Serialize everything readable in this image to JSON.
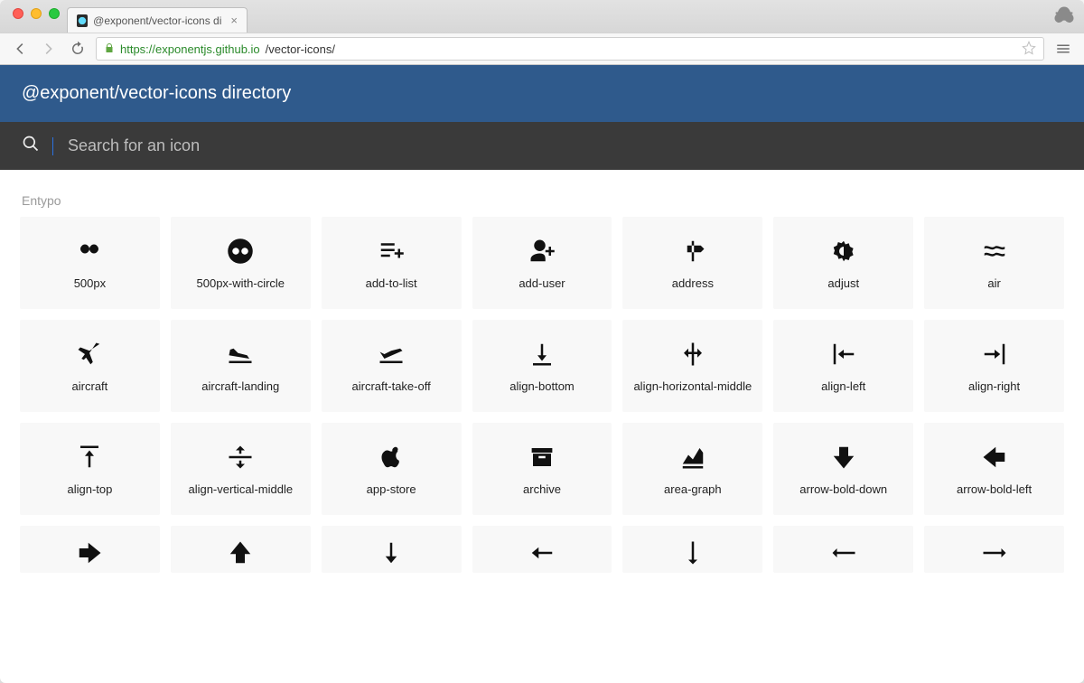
{
  "browser": {
    "tab_title": "@exponent/vector-icons di",
    "url_secure_host": "https://exponentjs.github.io",
    "url_path": "/vector-icons/"
  },
  "header": {
    "title": "@exponent/vector-icons directory"
  },
  "search": {
    "placeholder": "Search for an icon",
    "value": ""
  },
  "section": {
    "label": "Entypo"
  },
  "icons": [
    {
      "id": "500px",
      "label": "500px"
    },
    {
      "id": "500px-with-circle",
      "label": "500px-with-circle"
    },
    {
      "id": "add-to-list",
      "label": "add-to-list"
    },
    {
      "id": "add-user",
      "label": "add-user"
    },
    {
      "id": "address",
      "label": "address"
    },
    {
      "id": "adjust",
      "label": "adjust"
    },
    {
      "id": "air",
      "label": "air"
    },
    {
      "id": "aircraft",
      "label": "aircraft"
    },
    {
      "id": "aircraft-landing",
      "label": "aircraft-landing"
    },
    {
      "id": "aircraft-take-off",
      "label": "aircraft-take-off"
    },
    {
      "id": "align-bottom",
      "label": "align-bottom"
    },
    {
      "id": "align-horizontal-middle",
      "label": "align-horizontal-middle"
    },
    {
      "id": "align-left",
      "label": "align-left"
    },
    {
      "id": "align-right",
      "label": "align-right"
    },
    {
      "id": "align-top",
      "label": "align-top"
    },
    {
      "id": "align-vertical-middle",
      "label": "align-vertical-middle"
    },
    {
      "id": "app-store",
      "label": "app-store"
    },
    {
      "id": "archive",
      "label": "archive"
    },
    {
      "id": "area-graph",
      "label": "area-graph"
    },
    {
      "id": "arrow-bold-down",
      "label": "arrow-bold-down"
    },
    {
      "id": "arrow-bold-left",
      "label": "arrow-bold-left"
    },
    {
      "id": "arrow-bold-right",
      "label": "arrow-bold-right"
    },
    {
      "id": "arrow-bold-up",
      "label": "arrow-bold-up"
    },
    {
      "id": "arrow-down",
      "label": "arrow-down"
    },
    {
      "id": "arrow-left",
      "label": "arrow-left"
    },
    {
      "id": "arrow-long-down",
      "label": "arrow-long-down"
    },
    {
      "id": "arrow-long-left",
      "label": "arrow-long-left"
    },
    {
      "id": "arrow-long-right",
      "label": "arrow-long-right"
    }
  ]
}
